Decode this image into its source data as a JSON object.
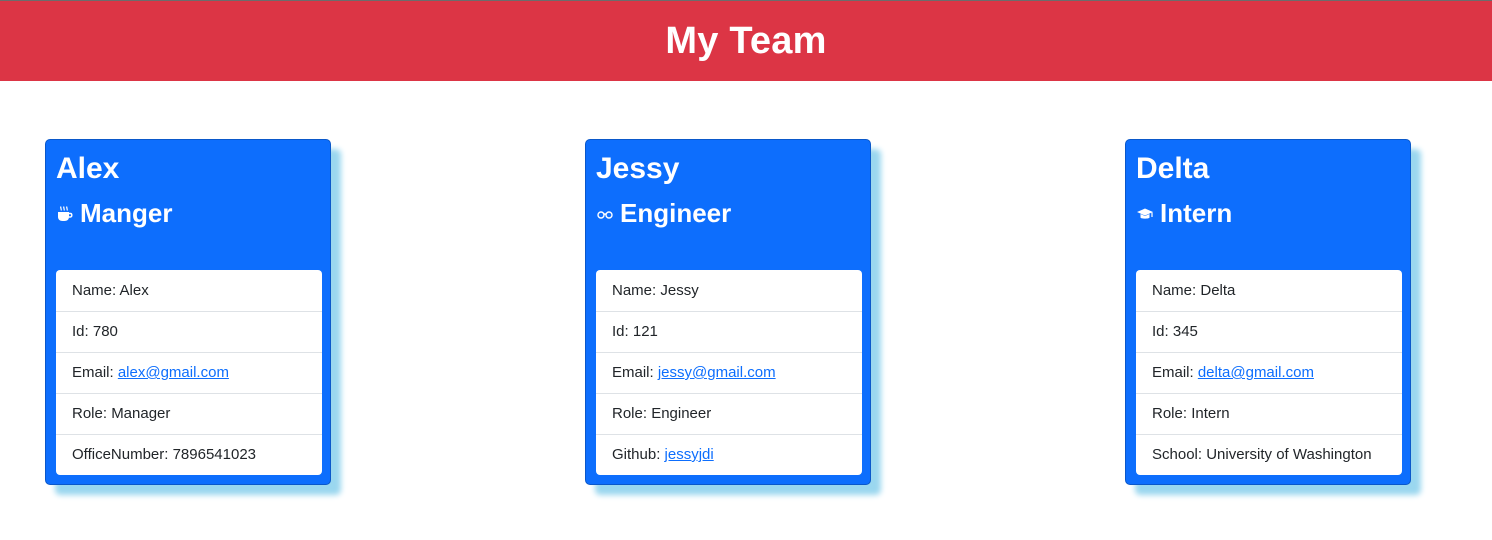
{
  "header": {
    "title": "My Team"
  },
  "colors": {
    "header_bg": "#dc3545",
    "card_bg": "#0d6efd",
    "link": "#0d6efd",
    "shadow": "#9ad7ef"
  },
  "cards": [
    {
      "name": "Alex",
      "role_title": "Manger",
      "role_icon": "coffee-cup-icon",
      "rows": [
        {
          "label": "Name: ",
          "value": "Alex"
        },
        {
          "label": "Id: ",
          "value": "780"
        },
        {
          "label": "Email: ",
          "value": "alex@gmail.com"
        },
        {
          "label": "Role: ",
          "value": "Manager"
        },
        {
          "label": "OfficeNumber: ",
          "value": "7896541023"
        }
      ]
    },
    {
      "name": "Jessy",
      "role_title": "Engineer",
      "role_icon": "glasses-icon",
      "rows": [
        {
          "label": "Name: ",
          "value": "Jessy"
        },
        {
          "label": "Id: ",
          "value": "121"
        },
        {
          "label": "Email: ",
          "value": "jessy@gmail.com"
        },
        {
          "label": "Role: ",
          "value": "Engineer"
        },
        {
          "label": "Github: ",
          "value": "jessyjdi"
        }
      ]
    },
    {
      "name": "Delta",
      "role_title": "Intern",
      "role_icon": "graduation-cap-icon",
      "rows": [
        {
          "label": "Name: ",
          "value": "Delta"
        },
        {
          "label": "Id: ",
          "value": "345"
        },
        {
          "label": "Email: ",
          "value": "delta@gmail.com"
        },
        {
          "label": "Role: ",
          "value": "Intern"
        },
        {
          "label": "School: ",
          "value": "University of Washington"
        }
      ]
    }
  ]
}
